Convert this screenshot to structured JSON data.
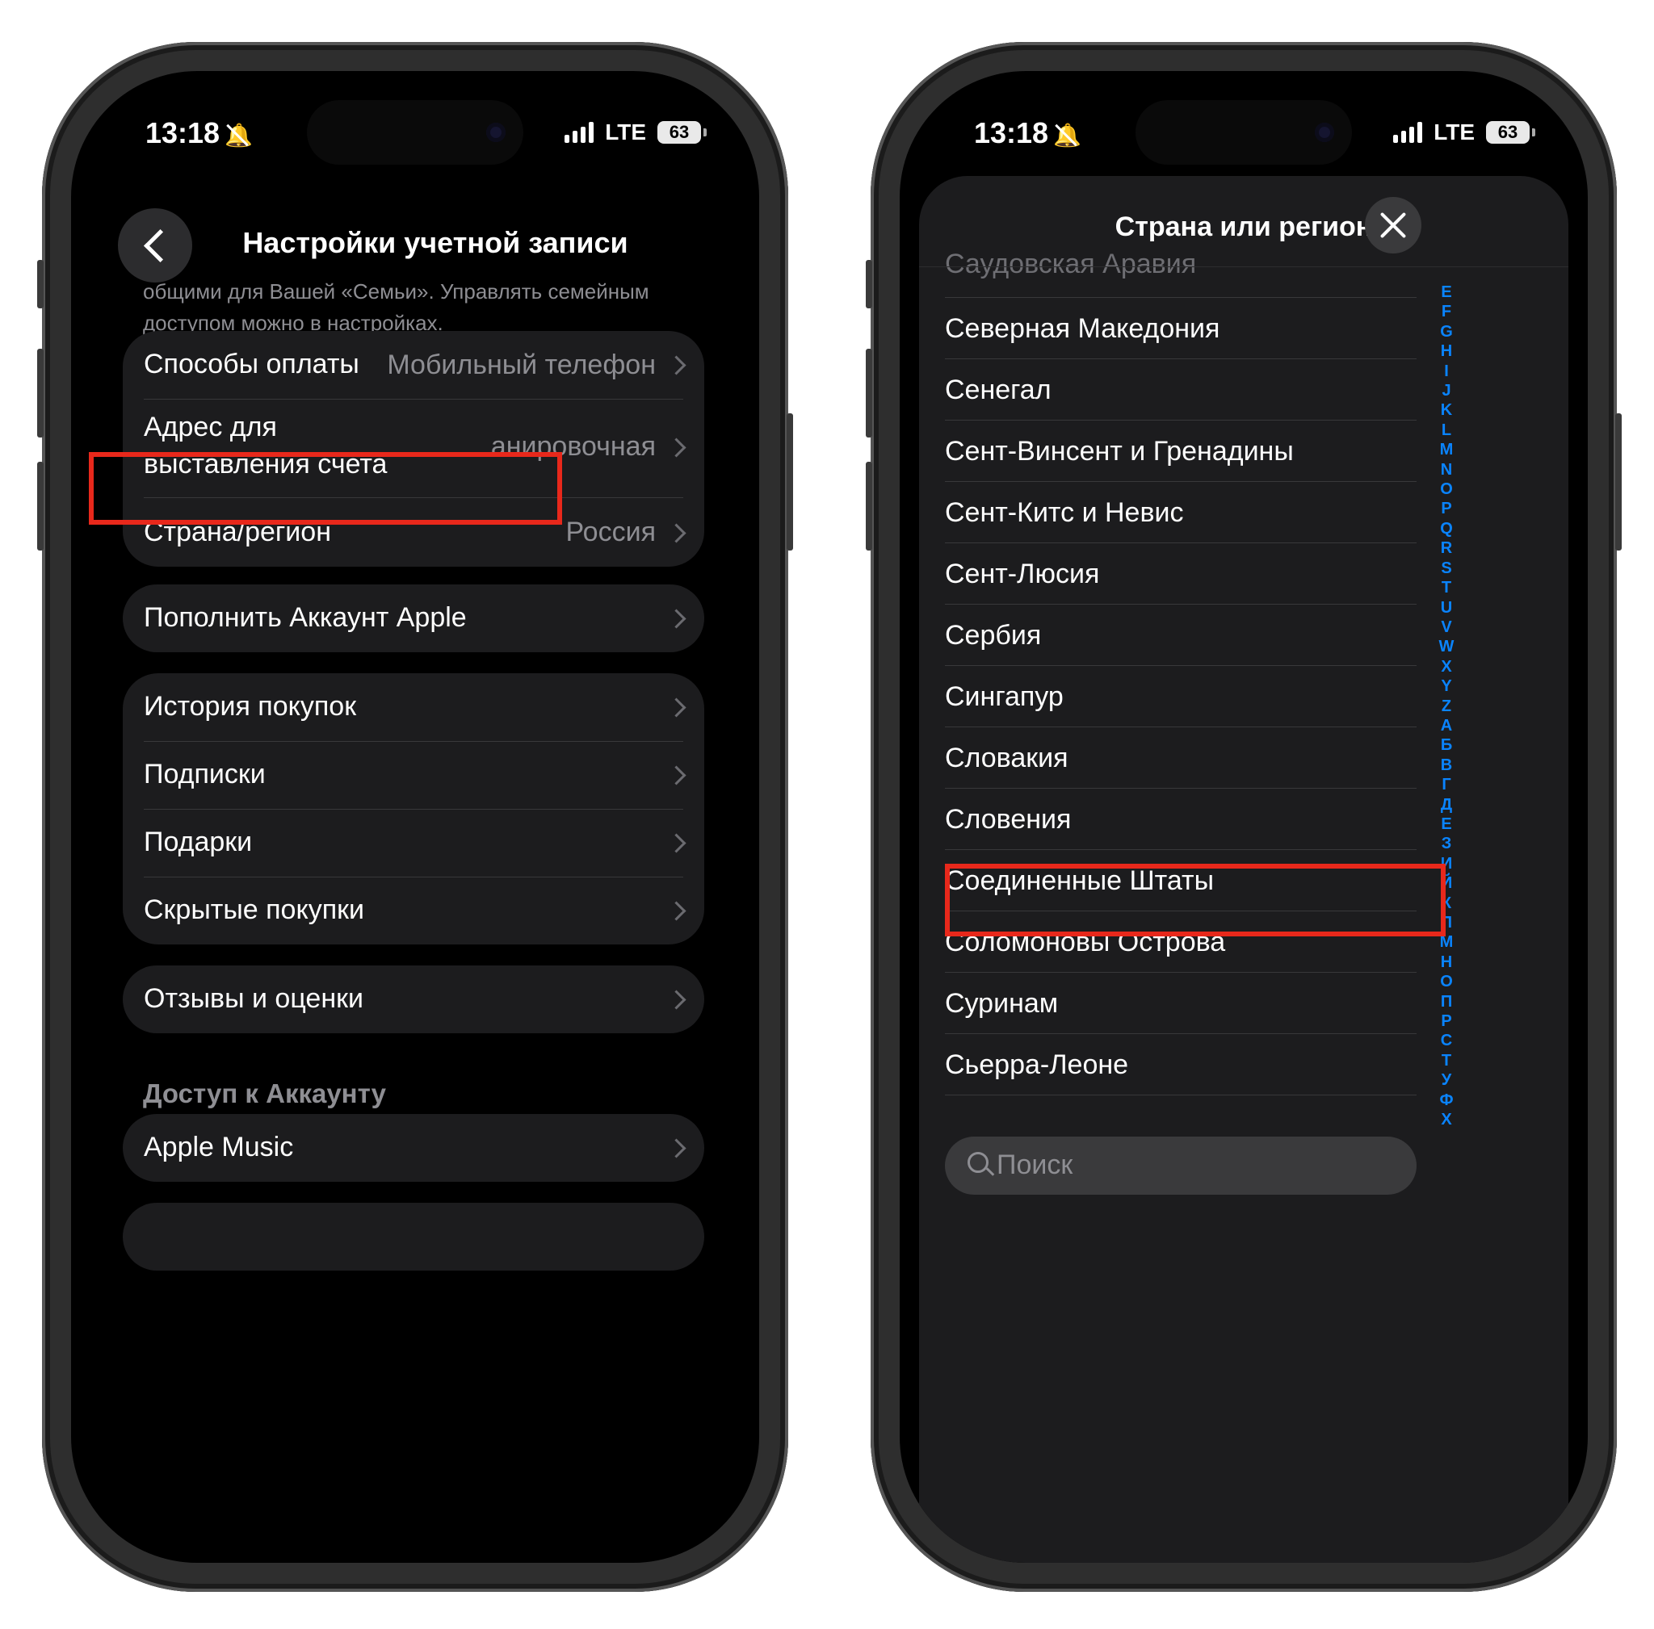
{
  "status": {
    "time": "13:18",
    "network": "LTE",
    "battery": "63"
  },
  "left": {
    "nav_title": "Настройки учетной записи",
    "description": "общими для Вашей «Семьи». Управлять семейным доступом можно в настройках.",
    "payment": {
      "label": "Способы оплаты",
      "value": "Мобильный телефон"
    },
    "billing": {
      "label": "Адрес для выставления счета",
      "value": "анировочная"
    },
    "country": {
      "label": "Страна/регион",
      "value": "Россия"
    },
    "topup": {
      "label": "Пополнить Аккаунт Apple"
    },
    "purchase_history": {
      "label": "История покупок"
    },
    "subscriptions": {
      "label": "Подписки"
    },
    "gifts": {
      "label": "Подарки"
    },
    "hidden_purchases": {
      "label": "Скрытые покупки"
    },
    "reviews": {
      "label": "Отзывы и оценки"
    },
    "section_access": "Доступ к Аккаунту",
    "apple_music": {
      "label": "Apple Music"
    }
  },
  "right": {
    "sheet_title": "Страна или регион",
    "partial_item": "Саудовская Аравия",
    "countries": [
      "Северная Македония",
      "Сенегал",
      "Сент-Винсент и Гренадины",
      "Сент-Китс и Невис",
      "Сент-Люсия",
      "Сербия",
      "Сингапур",
      "Словакия",
      "Словения",
      "Соединенные Штаты",
      "Соломоновы Острова",
      "Суринам",
      "Сьерра-Леоне"
    ],
    "highlighted_country": "Соединенные Штаты",
    "index_letters": [
      "E",
      "F",
      "G",
      "H",
      "I",
      "J",
      "K",
      "L",
      "M",
      "N",
      "O",
      "P",
      "Q",
      "R",
      "S",
      "T",
      "U",
      "V",
      "W",
      "X",
      "Y",
      "Z",
      "А",
      "Б",
      "В",
      "Г",
      "Д",
      "Е",
      "З",
      "И",
      "Й",
      "К",
      "Л",
      "М",
      "Н",
      "О",
      "П",
      "Р",
      "С",
      "Т",
      "У",
      "Ф",
      "Х"
    ],
    "search_placeholder": "Поиск"
  },
  "colors": {
    "highlight": "#e8281b",
    "accent": "#0a84ff",
    "background": "#000000",
    "cell": "#1c1c1e"
  }
}
